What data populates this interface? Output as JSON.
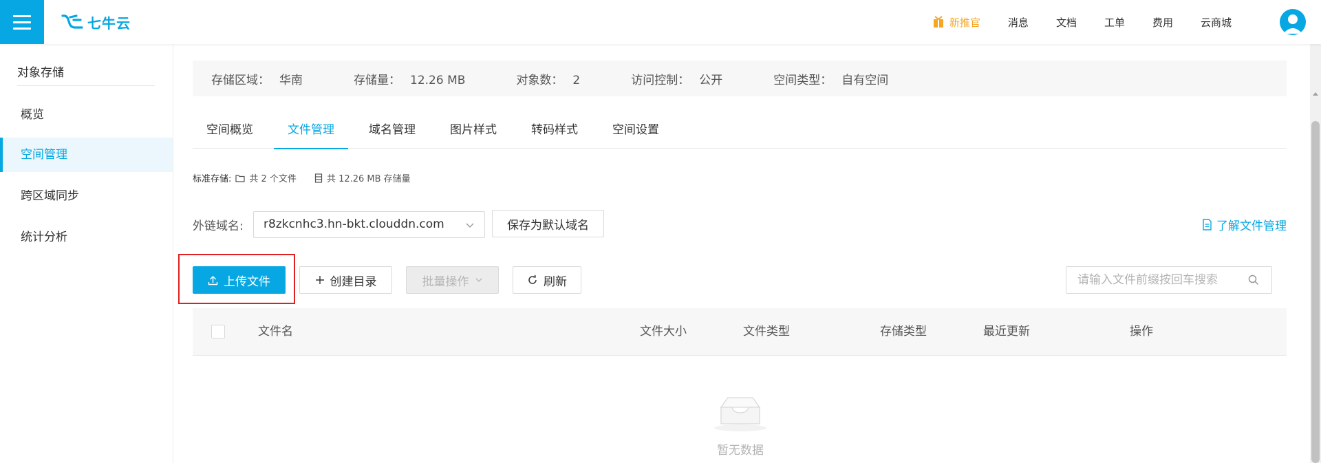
{
  "brand": {
    "logo_text": "七牛云",
    "accent": "#06a7e2"
  },
  "topnav": [
    {
      "label": "新推官",
      "icon": "gift-icon",
      "highlight": true
    },
    {
      "label": "消息"
    },
    {
      "label": "文档"
    },
    {
      "label": "工单"
    },
    {
      "label": "费用"
    },
    {
      "label": "云商城"
    }
  ],
  "sidebar": {
    "title": "对象存储",
    "items": [
      {
        "label": "概览",
        "active": false
      },
      {
        "label": "空间管理",
        "active": true
      },
      {
        "label": "跨区域同步",
        "active": false
      },
      {
        "label": "统计分析",
        "active": false
      }
    ]
  },
  "bucket_info": [
    {
      "key": "存储区域：",
      "value": "华南"
    },
    {
      "key": "存储量：",
      "value": "12.26 MB"
    },
    {
      "key": "对象数：",
      "value": "2"
    },
    {
      "key": "访问控制：",
      "value": "公开"
    },
    {
      "key": "空间类型：",
      "value": "自有空间"
    }
  ],
  "tabs": [
    {
      "label": "空间概览",
      "active": false
    },
    {
      "label": "文件管理",
      "active": true
    },
    {
      "label": "域名管理",
      "active": false
    },
    {
      "label": "图片样式",
      "active": false
    },
    {
      "label": "转码样式",
      "active": false
    },
    {
      "label": "空间设置",
      "active": false
    }
  ],
  "summary": {
    "label": "标准存储:",
    "files": "共 2 个文件",
    "size": "共 12.26 MB 存储量"
  },
  "domain": {
    "label": "外链域名:",
    "value": "r8zkcnhc3.hn-bkt.clouddn.com",
    "save_default": "保存为默认域名",
    "learn_more": "了解文件管理"
  },
  "actions": {
    "upload": "上传文件",
    "create_dir": "创建目录",
    "batch": "批量操作",
    "refresh": "刷新",
    "search_placeholder": "请输入文件前缀按回车搜索"
  },
  "table": {
    "columns": [
      "文件名",
      "文件大小",
      "文件类型",
      "存储类型",
      "最近更新",
      "操作"
    ],
    "rows": [],
    "empty_text": "暂无数据"
  }
}
